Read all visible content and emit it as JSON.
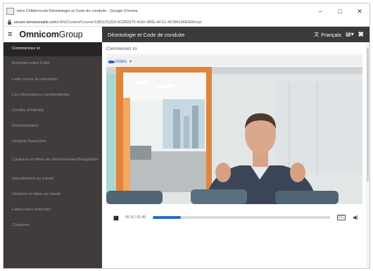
{
  "window": {
    "title": "Intra Childen/corb-Déontologie et Code de conduite - Google Chrome",
    "minimize": "–",
    "maximize": "□",
    "close": "✕"
  },
  "address": {
    "host": "secure.terranovasite.com",
    "path": "/LMS/Content/Course/13811/21329-9CD82270-4190-486E-AF1C-4678A106E968/ncp/"
  },
  "app": {
    "logo_bold": "Omnicom",
    "logo_light": "Group",
    "page_title": "Déontologie et Code de conduite",
    "language": "Français"
  },
  "sidebar": {
    "items": [
      {
        "label": "Commencez ici",
        "active": true
      },
      {
        "label": "Explorez notre Code"
      },
      {
        "label": "Lutte contre la corruption"
      },
      {
        "label": "Les informations confidentielles"
      },
      {
        "label": "Conflits d'intérêts"
      },
      {
        "label": "Discrimination"
      },
      {
        "label": "Intégrité financière"
      },
      {
        "label": "Cadeaux et offres de divertissement/hospitalité"
      },
      {
        "label": "Harcèlement au travail"
      },
      {
        "label": "Violence et abus au travail"
      },
      {
        "label": "Faites-vous entendre"
      },
      {
        "label": "Coopérer"
      }
    ]
  },
  "content": {
    "breadcrumb": "Commencez ici",
    "video_label": "Vidéo",
    "player": {
      "time": "00:16 / 01:49",
      "progress": 0.16,
      "cc_label": "CC"
    }
  },
  "colors": {
    "sidebar_bg": "#3f3c3b",
    "sidebar_active": "#262424",
    "appbar_bg": "#3a3a3a",
    "accent": "#2b6cc3",
    "door_frame": "#e2843b"
  }
}
